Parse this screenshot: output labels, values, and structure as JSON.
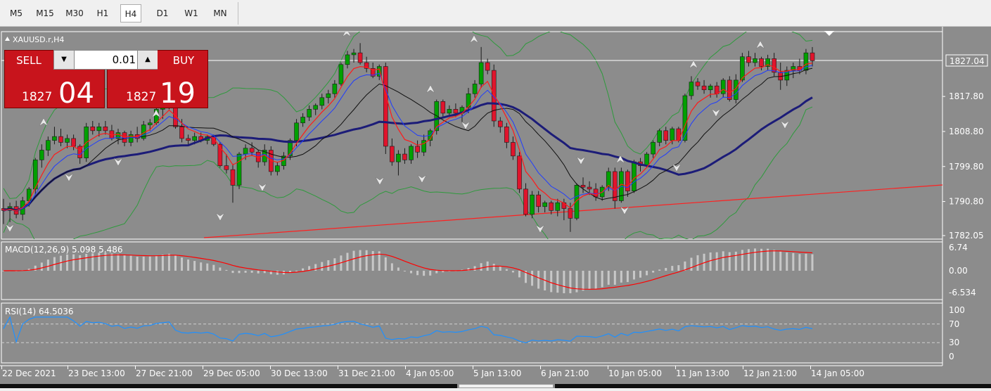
{
  "timeframes": [
    "M5",
    "M15",
    "M30",
    "H1",
    "H4",
    "D1",
    "W1",
    "MN"
  ],
  "active_timeframe": "H4",
  "symbol_title": "XAUUSD.r,H4",
  "trade_panel": {
    "sell_label": "SELL",
    "buy_label": "BUY",
    "volume": "0.01",
    "sell_price_small": "1827",
    "sell_price_big": "04",
    "buy_price_small": "1827",
    "buy_price_big": "19",
    "down_arrow": "▼",
    "up_arrow": "▲"
  },
  "price_axis": {
    "current_price": "1827.04",
    "ticks": [
      "1817.80",
      "1808.80",
      "1799.80",
      "1790.80",
      "1782.05"
    ]
  },
  "macd": {
    "label": "MACD(12,26,9) 5.098 5.486",
    "ticks": [
      "6.74",
      "0.00",
      "-6.534"
    ]
  },
  "rsi": {
    "label": "RSI(14) 64.5036",
    "ticks": [
      "100",
      "70",
      "30",
      "0"
    ]
  },
  "time_axis": [
    "22 Dec 2021",
    "23 Dec 13:00",
    "27 Dec 21:00",
    "29 Dec 05:00",
    "30 Dec 13:00",
    "31 Dec 21:00",
    "4 Jan 05:00",
    "5 Jan 13:00",
    "6 Jan 21:00",
    "10 Jan 05:00",
    "11 Jan 13:00",
    "12 Jan 21:00",
    "14 Jan 05:00"
  ],
  "colors": {
    "background": "#8c8c8c",
    "bull_candle": "#00a000",
    "bear_candle": "#e0142c",
    "ma_navy": "#1c1c78",
    "ma_blue": "#1f3cff",
    "ma_red": "#ff1a1a",
    "ma_black": "#101010",
    "bollinger": "#2e9a3c",
    "trendline": "#ff2020",
    "macd_signal": "#ff0000",
    "macd_hist": "#c8c8c8",
    "rsi_line": "#1e90ff",
    "sell_button": "#c8141c"
  },
  "chart_data": {
    "type": "candlestick",
    "timeframe": "H4",
    "candles_ohlc": [
      [
        1789.0,
        1791.5,
        1785.0,
        1788.5
      ],
      [
        1788.5,
        1790.5,
        1785.5,
        1789.5
      ],
      [
        1789.5,
        1791.0,
        1786.5,
        1787.5
      ],
      [
        1787.5,
        1792.0,
        1786.0,
        1791.0
      ],
      [
        1791.0,
        1794.5,
        1789.5,
        1794.0
      ],
      [
        1794.0,
        1802.0,
        1792.5,
        1801.5
      ],
      [
        1801.5,
        1805.5,
        1799.5,
        1804.0
      ],
      [
        1804.0,
        1807.5,
        1802.5,
        1806.5
      ],
      [
        1806.5,
        1810.0,
        1805.5,
        1807.5
      ],
      [
        1807.5,
        1809.5,
        1805.0,
        1806.0
      ],
      [
        1806.0,
        1808.0,
        1804.5,
        1807.0
      ],
      [
        1807.0,
        1808.0,
        1804.0,
        1805.0
      ],
      [
        1805.0,
        1805.5,
        1800.5,
        1802.0
      ],
      [
        1802.0,
        1811.0,
        1801.0,
        1810.0
      ],
      [
        1810.0,
        1811.5,
        1808.0,
        1809.0
      ],
      [
        1809.0,
        1811.0,
        1807.5,
        1810.0
      ],
      [
        1810.0,
        1811.5,
        1808.0,
        1809.0
      ],
      [
        1809.0,
        1810.5,
        1806.5,
        1807.0
      ],
      [
        1807.0,
        1809.5,
        1805.5,
        1808.5
      ],
      [
        1808.5,
        1809.0,
        1805.0,
        1806.0
      ],
      [
        1806.0,
        1809.0,
        1805.0,
        1808.0
      ],
      [
        1808.0,
        1810.0,
        1806.0,
        1807.0
      ],
      [
        1807.0,
        1811.5,
        1806.5,
        1810.5
      ],
      [
        1810.5,
        1812.0,
        1809.0,
        1811.0
      ],
      [
        1811.0,
        1815.5,
        1810.5,
        1814.5
      ],
      [
        1814.5,
        1817.0,
        1812.0,
        1816.0
      ],
      [
        1816.0,
        1818.0,
        1814.5,
        1817.5
      ],
      [
        1817.5,
        1818.5,
        1809.5,
        1810.0
      ],
      [
        1810.0,
        1812.0,
        1806.0,
        1807.0
      ],
      [
        1807.0,
        1808.0,
        1805.5,
        1806.5
      ],
      [
        1806.5,
        1808.5,
        1805.5,
        1807.5
      ],
      [
        1807.5,
        1808.5,
        1806.0,
        1806.5
      ],
      [
        1806.5,
        1808.0,
        1805.5,
        1807.5
      ],
      [
        1807.5,
        1808.0,
        1805.0,
        1805.5
      ],
      [
        1805.5,
        1806.0,
        1799.5,
        1800.0
      ],
      [
        1800.0,
        1803.0,
        1798.0,
        1799.0
      ],
      [
        1799.0,
        1800.5,
        1790.5,
        1795.0
      ],
      [
        1795.0,
        1803.5,
        1794.0,
        1803.0
      ],
      [
        1803.0,
        1805.5,
        1801.5,
        1804.5
      ],
      [
        1804.5,
        1806.0,
        1802.5,
        1803.5
      ],
      [
        1803.5,
        1804.0,
        1799.5,
        1801.0
      ],
      [
        1801.0,
        1805.5,
        1800.0,
        1804.0
      ],
      [
        1804.0,
        1805.0,
        1797.5,
        1798.5
      ],
      [
        1798.5,
        1801.0,
        1797.5,
        1800.0
      ],
      [
        1800.0,
        1803.5,
        1799.0,
        1802.5
      ],
      [
        1802.5,
        1807.0,
        1801.5,
        1806.5
      ],
      [
        1806.5,
        1812.0,
        1805.0,
        1811.0
      ],
      [
        1811.0,
        1813.5,
        1810.0,
        1812.5
      ],
      [
        1812.5,
        1815.5,
        1811.5,
        1814.5
      ],
      [
        1814.5,
        1816.0,
        1813.0,
        1815.5
      ],
      [
        1815.5,
        1818.5,
        1814.5,
        1817.5
      ],
      [
        1817.5,
        1819.5,
        1816.0,
        1818.5
      ],
      [
        1818.5,
        1822.0,
        1817.5,
        1821.0
      ],
      [
        1821.0,
        1826.5,
        1820.5,
        1826.0
      ],
      [
        1826.0,
        1829.5,
        1825.0,
        1828.5
      ],
      [
        1828.5,
        1830.0,
        1826.5,
        1829.0
      ],
      [
        1829.0,
        1831.5,
        1826.0,
        1826.5
      ],
      [
        1826.5,
        1828.0,
        1824.0,
        1825.0
      ],
      [
        1825.0,
        1826.5,
        1822.5,
        1823.0
      ],
      [
        1823.0,
        1826.0,
        1822.0,
        1825.5
      ],
      [
        1825.5,
        1826.5,
        1803.0,
        1805.0
      ],
      [
        1805.0,
        1807.0,
        1800.0,
        1801.0
      ],
      [
        1801.0,
        1804.0,
        1797.5,
        1803.0
      ],
      [
        1803.0,
        1804.5,
        1800.5,
        1801.5
      ],
      [
        1801.5,
        1805.5,
        1800.5,
        1805.0
      ],
      [
        1805.0,
        1806.5,
        1802.0,
        1803.5
      ],
      [
        1803.5,
        1808.0,
        1802.5,
        1806.5
      ],
      [
        1806.5,
        1809.5,
        1805.0,
        1809.0
      ],
      [
        1809.0,
        1817.0,
        1808.0,
        1816.5
      ],
      [
        1816.5,
        1817.0,
        1812.5,
        1813.5
      ],
      [
        1813.5,
        1815.5,
        1812.5,
        1814.5
      ],
      [
        1814.5,
        1816.0,
        1812.5,
        1813.5
      ],
      [
        1813.5,
        1815.5,
        1811.0,
        1815.0
      ],
      [
        1815.0,
        1820.0,
        1813.5,
        1818.5
      ],
      [
        1818.5,
        1822.0,
        1817.5,
        1821.0
      ],
      [
        1821.0,
        1830.5,
        1820.0,
        1826.5
      ],
      [
        1826.5,
        1827.5,
        1823.5,
        1824.5
      ],
      [
        1824.5,
        1826.0,
        1810.0,
        1811.5
      ],
      [
        1811.5,
        1812.5,
        1808.5,
        1810.0
      ],
      [
        1810.0,
        1811.0,
        1804.5,
        1806.0
      ],
      [
        1806.0,
        1807.5,
        1801.5,
        1802.5
      ],
      [
        1802.5,
        1803.5,
        1793.0,
        1794.0
      ],
      [
        1794.0,
        1795.5,
        1787.0,
        1787.5
      ],
      [
        1787.5,
        1793.5,
        1786.5,
        1792.5
      ],
      [
        1792.5,
        1793.5,
        1788.0,
        1789.5
      ],
      [
        1789.5,
        1791.0,
        1788.0,
        1790.5
      ],
      [
        1790.5,
        1791.0,
        1787.5,
        1788.5
      ],
      [
        1788.5,
        1791.5,
        1787.0,
        1790.5
      ],
      [
        1790.5,
        1791.5,
        1786.0,
        1789.0
      ],
      [
        1789.0,
        1790.5,
        1783.0,
        1786.5
      ],
      [
        1786.5,
        1795.5,
        1786.0,
        1795.0
      ],
      [
        1795.0,
        1797.0,
        1793.0,
        1794.5
      ],
      [
        1794.5,
        1796.0,
        1792.5,
        1794.0
      ],
      [
        1794.0,
        1795.5,
        1791.0,
        1792.0
      ],
      [
        1792.0,
        1795.0,
        1791.0,
        1794.5
      ],
      [
        1794.5,
        1799.5,
        1793.5,
        1798.5
      ],
      [
        1798.5,
        1799.5,
        1789.0,
        1791.0
      ],
      [
        1791.0,
        1799.5,
        1790.5,
        1798.5
      ],
      [
        1798.5,
        1799.0,
        1792.0,
        1793.5
      ],
      [
        1793.5,
        1801.5,
        1793.0,
        1801.0
      ],
      [
        1801.0,
        1802.0,
        1798.5,
        1800.0
      ],
      [
        1800.0,
        1803.5,
        1799.5,
        1803.0
      ],
      [
        1803.0,
        1806.5,
        1802.0,
        1806.0
      ],
      [
        1806.0,
        1809.5,
        1805.0,
        1809.0
      ],
      [
        1809.0,
        1810.0,
        1805.5,
        1806.5
      ],
      [
        1806.5,
        1810.0,
        1805.5,
        1809.5
      ],
      [
        1809.5,
        1810.0,
        1806.0,
        1806.5
      ],
      [
        1806.5,
        1818.5,
        1806.0,
        1818.0
      ],
      [
        1818.0,
        1823.0,
        1817.0,
        1821.5
      ],
      [
        1821.5,
        1822.5,
        1819.5,
        1820.5
      ],
      [
        1820.5,
        1822.0,
        1818.5,
        1819.5
      ],
      [
        1819.5,
        1821.0,
        1817.5,
        1820.5
      ],
      [
        1820.5,
        1821.5,
        1817.5,
        1818.5
      ],
      [
        1818.5,
        1822.5,
        1817.5,
        1822.0
      ],
      [
        1822.0,
        1823.0,
        1816.5,
        1817.0
      ],
      [
        1817.0,
        1823.5,
        1816.0,
        1822.0
      ],
      [
        1822.0,
        1829.0,
        1821.5,
        1828.0
      ],
      [
        1828.0,
        1829.5,
        1825.5,
        1826.5
      ],
      [
        1826.5,
        1829.0,
        1825.5,
        1827.5
      ],
      [
        1827.5,
        1828.0,
        1824.5,
        1825.5
      ],
      [
        1825.5,
        1828.5,
        1824.5,
        1827.5
      ],
      [
        1827.5,
        1829.0,
        1823.0,
        1824.0
      ],
      [
        1824.0,
        1826.5,
        1819.5,
        1822.0
      ],
      [
        1822.0,
        1825.5,
        1820.5,
        1824.5
      ],
      [
        1824.5,
        1826.5,
        1822.5,
        1825.5
      ],
      [
        1825.5,
        1827.5,
        1823.5,
        1824.5
      ],
      [
        1824.5,
        1830.0,
        1823.5,
        1829.0
      ],
      [
        1829.0,
        1830.5,
        1825.5,
        1827.0
      ]
    ],
    "current_price": 1827.04,
    "price_range": [
      1782.05,
      1834.5
    ],
    "macd_range": [
      -6.534,
      6.74
    ],
    "rsi_range": [
      0,
      100
    ],
    "rsi_levels": [
      70,
      30
    ],
    "grid": false
  }
}
